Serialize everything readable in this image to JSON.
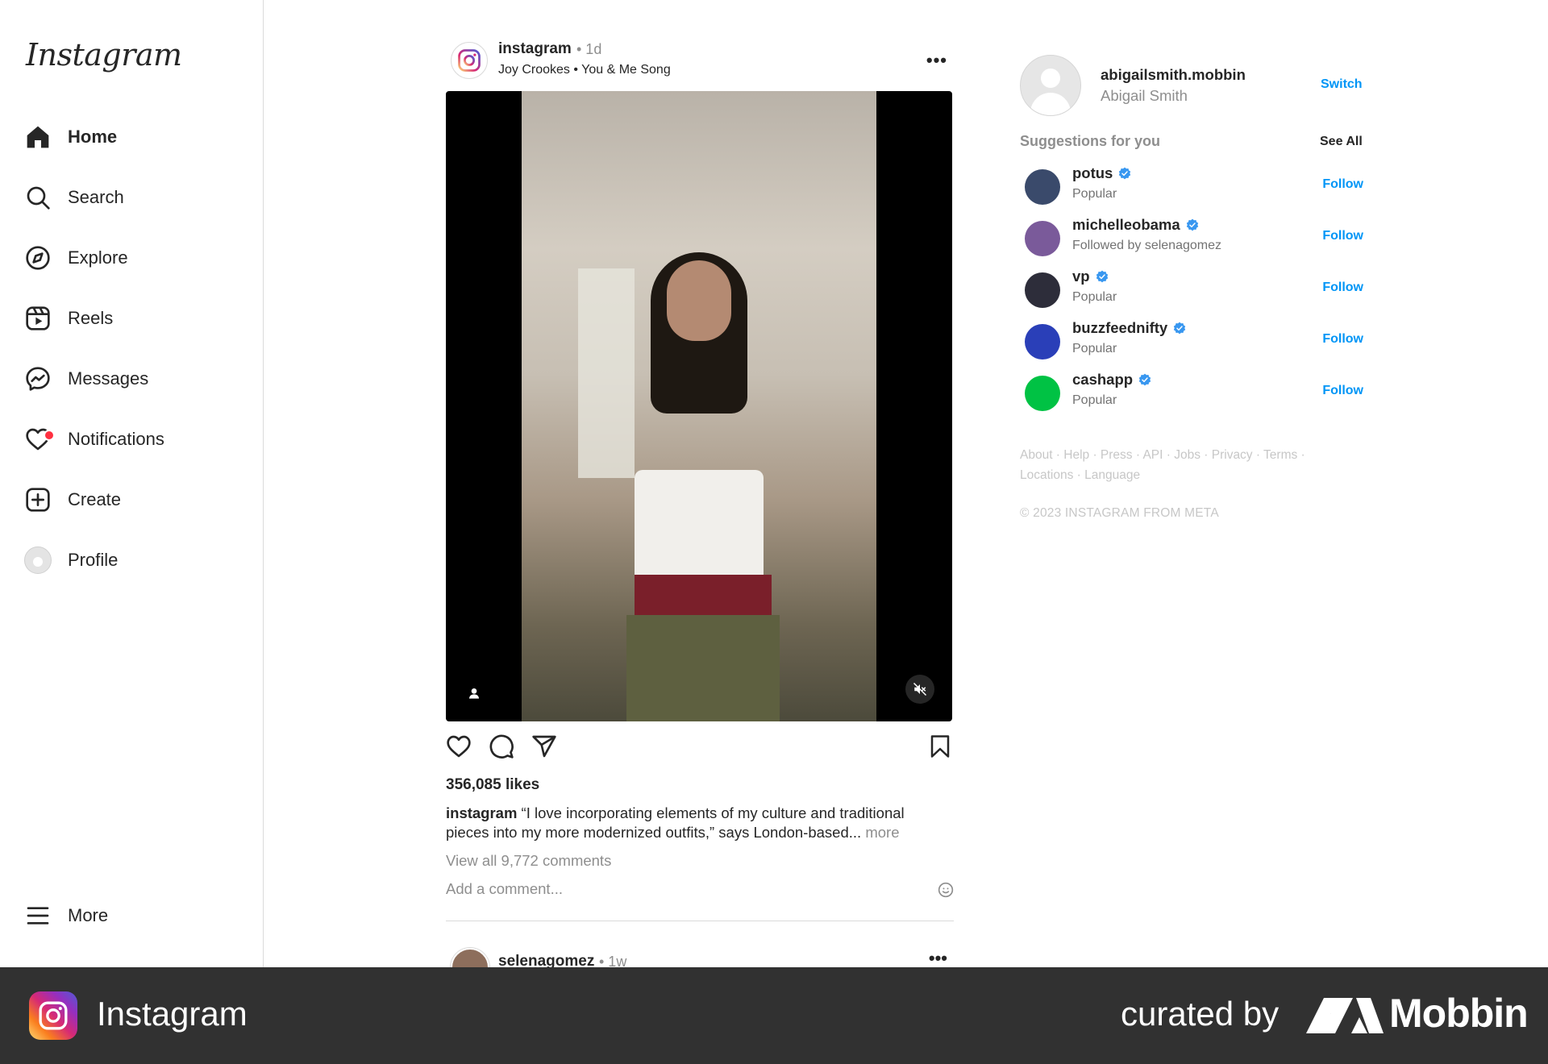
{
  "app": {
    "logo_text": "Instagram"
  },
  "nav": {
    "home": "Home",
    "search": "Search",
    "explore": "Explore",
    "reels": "Reels",
    "messages": "Messages",
    "notifications": "Notifications",
    "create": "Create",
    "profile": "Profile",
    "more": "More"
  },
  "post": {
    "username": "instagram",
    "time": "• 1d",
    "audio": "Joy Crookes • You & Me Song",
    "likes": "356,085 likes",
    "caption_user": "instagram",
    "caption_text": " “I love incorporating elements of my culture and traditional pieces into my more modernized outfits,” says London-based...",
    "caption_more": " more",
    "view_comments": "View all 9,772 comments",
    "comment_placeholder": "Add a comment..."
  },
  "post2": {
    "username": "selenagomez",
    "time": "• 1w"
  },
  "account": {
    "username": "abigailsmith.mobbin",
    "name": "Abigail Smith",
    "switch_label": "Switch"
  },
  "suggestions": {
    "title": "Suggestions for you",
    "see_all": "See All",
    "follow_label": "Follow",
    "items": [
      {
        "username": "potus",
        "subtitle": "Popular",
        "avatar_color": "#3a4a6b"
      },
      {
        "username": "michelleobama",
        "subtitle": "Followed by selenagomez",
        "avatar_color": "#7a5a9a"
      },
      {
        "username": "vp",
        "subtitle": "Popular",
        "avatar_color": "#2d2d3a"
      },
      {
        "username": "buzzfeednifty",
        "subtitle": "Popular",
        "avatar_color": "#2a3fb8"
      },
      {
        "username": "cashapp",
        "subtitle": "Popular",
        "avatar_color": "#00c244"
      }
    ]
  },
  "footer": {
    "links_line1": "About · Help · Press · API · Jobs · Privacy · Terms ·",
    "links_line2": "Locations · Language",
    "copyright": "© 2023 INSTAGRAM FROM META"
  },
  "brand_bar": {
    "app_name": "Instagram",
    "curated_by": "curated by",
    "mobbin": "Mobbin"
  },
  "colors": {
    "accent": "#0095f6",
    "notification_dot": "#ff3040",
    "verified": "#3897f0",
    "brand_bar_bg": "#313131"
  },
  "icons": [
    "home-icon",
    "search-icon",
    "explore-icon",
    "reels-icon",
    "messages-icon",
    "heart-icon",
    "create-icon",
    "more-icon",
    "comment-icon",
    "share-icon",
    "bookmark-icon",
    "mute-icon",
    "user-tag-icon",
    "emoji-icon",
    "verified-icon"
  ]
}
